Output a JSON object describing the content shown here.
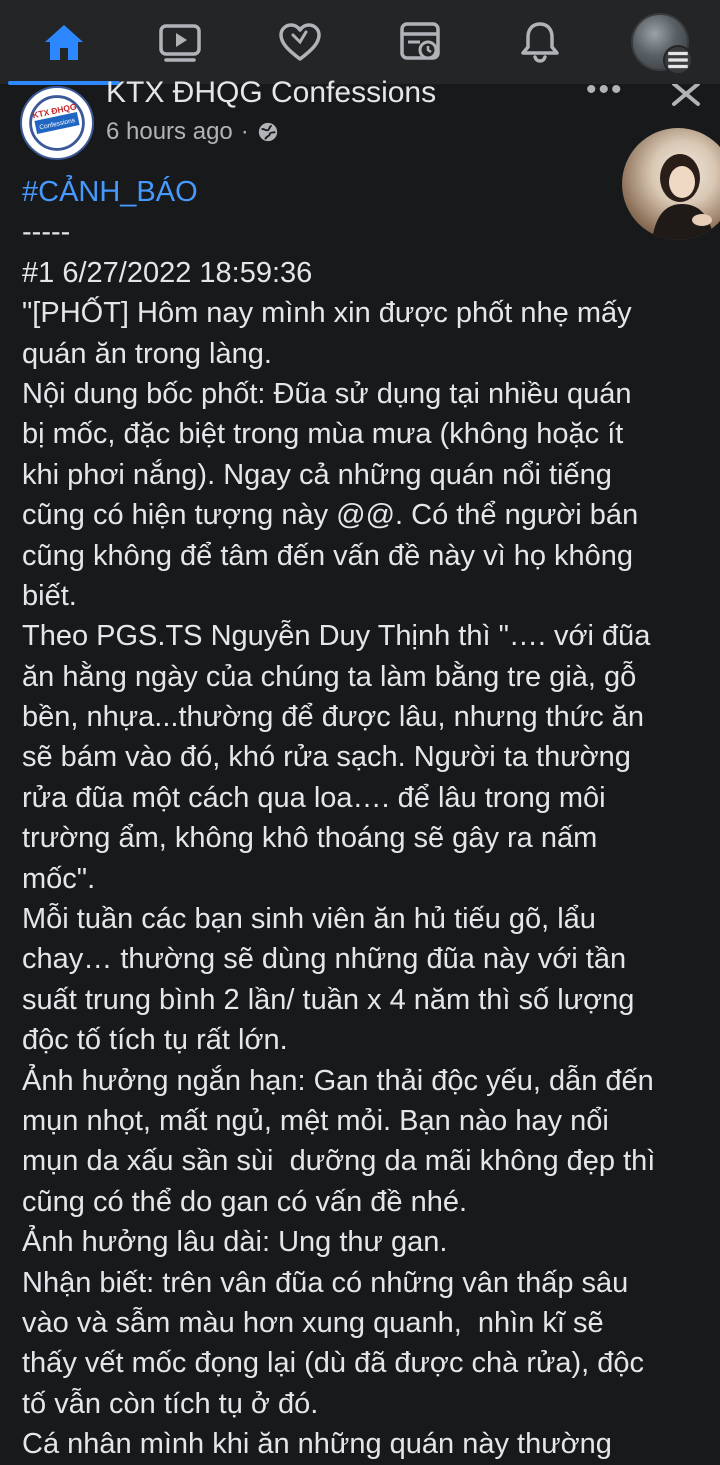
{
  "nav": {
    "items": [
      {
        "id": "home",
        "icon": "home-icon",
        "active": true
      },
      {
        "id": "watch",
        "icon": "video-icon"
      },
      {
        "id": "dating",
        "icon": "heart-icon"
      },
      {
        "id": "memories",
        "icon": "memories-icon"
      },
      {
        "id": "notifications",
        "icon": "bell-icon"
      },
      {
        "id": "menu",
        "icon": "profile-avatar-icon"
      }
    ],
    "accent": "#2d88ff"
  },
  "post": {
    "page_name": "KTX ĐHQG Confessions",
    "logo_text": "KTX ĐHQG Confessions",
    "time": "6 hours ago",
    "privacy_icon": "globe-icon",
    "hashtag": "#CẢNH_BÁO",
    "lines": [
      "-----",
      "#1 6/27/2022 18:59:36",
      "\"[PHỐT] Hôm nay mình xin được phốt nhẹ mấy",
      "quán ăn trong làng.",
      "Nội dung bốc phốt: Đũa sử dụng tại nhiều quán",
      "bị mốc, đặc biệt trong mùa mưa (không hoặc ít",
      "khi phơi nắng). Ngay cả những quán nổi tiếng",
      "cũng có hiện tượng này @@. Có thể người bán",
      "cũng không để tâm đến vấn đề này vì họ không",
      "biết.",
      "Theo PGS.TS Nguyễn Duy Thịnh thì \"…. với đũa",
      "ăn hằng ngày của chúng ta làm bằng tre già, gỗ",
      "bền, nhựa...thường để được lâu, nhưng thức ăn",
      "sẽ bám vào đó, khó rửa sạch. Người ta thường",
      "rửa đũa một cách qua loa…. để lâu trong môi",
      "trường ẩm, không khô thoáng sẽ gây ra nấm",
      "mốc\".",
      "Mỗi tuần các bạn sinh viên ăn hủ tiếu gõ, lẩu",
      "chay… thường sẽ dùng những đũa này với tần",
      "suất trung bình 2 lần/ tuần x 4 năm thì số lượng",
      "độc tố tích tụ rất lớn.",
      "Ảnh hưởng ngắn hạn: Gan thải độc yếu, dẫn đến",
      "mụn nhọt, mất ngủ, mệt mỏi. Bạn nào hay nổi",
      "mụn da xấu sần sùi  dưỡng da mãi không đẹp thì",
      "cũng có thể do gan có vấn đề nhé.",
      "Ảnh hưởng lâu dài: Ung thư gan.",
      "Nhận biết: trên vân đũa có những vân thấp sâu",
      "vào và sẫm màu hơn xung quanh,  nhìn kĩ sẽ",
      "thấy vết mốc đọng lại (dù đã được chà rửa), độc",
      "tố vẫn còn tích tụ ở đó.",
      "Cá nhân mình khi ăn những quán này thường"
    ]
  }
}
